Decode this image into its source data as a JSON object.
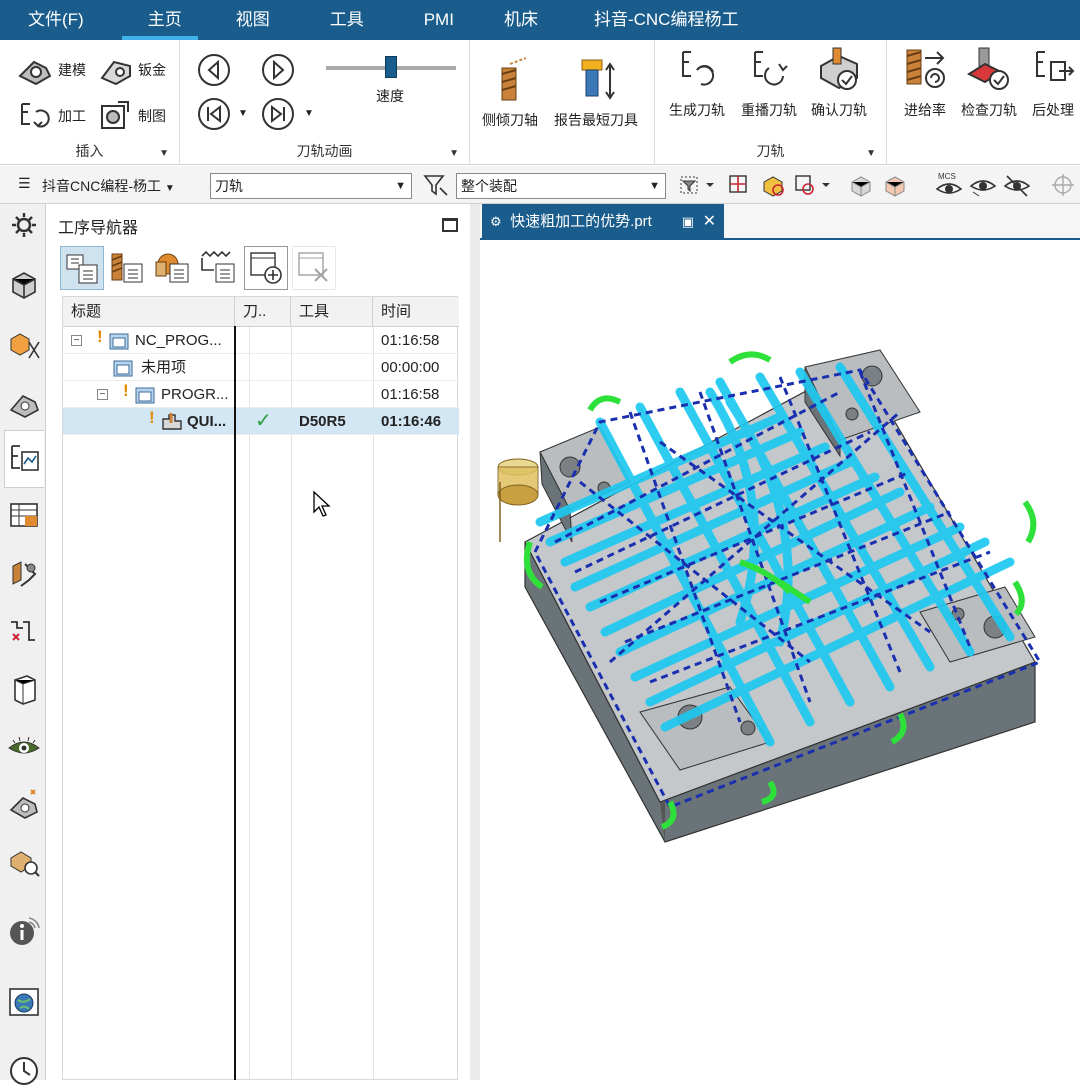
{
  "menubar": {
    "items": [
      "文件(F)",
      "主页",
      "视图",
      "工具",
      "PMI",
      "机床",
      "抖音-CNC编程杨工"
    ],
    "active_index": 1
  },
  "ribbon": {
    "insert": {
      "label": "插入",
      "buttons": [
        "建模",
        "钣金",
        "加工",
        "制图"
      ]
    },
    "animation": {
      "label": "刀轨动画",
      "speed_label": "速度",
      "speed_value": 0.5
    },
    "tool_axis": {
      "buttons": [
        "侧倾刀轴",
        "报告最短刀具"
      ]
    },
    "toolpath": {
      "label": "刀轨",
      "buttons": [
        "生成刀轨",
        "重播刀轨",
        "确认刀轨"
      ]
    },
    "more": {
      "buttons": [
        "进给率",
        "检查刀轨",
        "后处理"
      ]
    }
  },
  "toolbar2": {
    "menu_label": "抖音CNC编程-杨工",
    "filter_combo": "刀轨",
    "scope_combo": "整个装配",
    "mcs_label": "MCS"
  },
  "navigator": {
    "title": "工序导航器",
    "columns": [
      "标题",
      "刀..",
      "工具",
      "时间"
    ],
    "rows": [
      {
        "name": "NC_PROG...",
        "check": "",
        "tool": "",
        "time": "01:16:58"
      },
      {
        "name": "未用项",
        "check": "",
        "tool": "",
        "time": "00:00:00"
      },
      {
        "name": "PROGR...",
        "check": "",
        "tool": "",
        "time": "01:16:58"
      },
      {
        "name": "QUI...",
        "check": "✓",
        "tool": "D50R5",
        "time": "01:16:46"
      }
    ]
  },
  "viewport": {
    "tab_title": "快速粗加工的优势.prt"
  },
  "colors": {
    "accent": "#1a5d8c",
    "highlight": "#3fb1e8",
    "toolpath_cyan": "#1ec8f0",
    "toolpath_blue": "#1a2fb0",
    "toolpath_green": "#2ee03a"
  }
}
